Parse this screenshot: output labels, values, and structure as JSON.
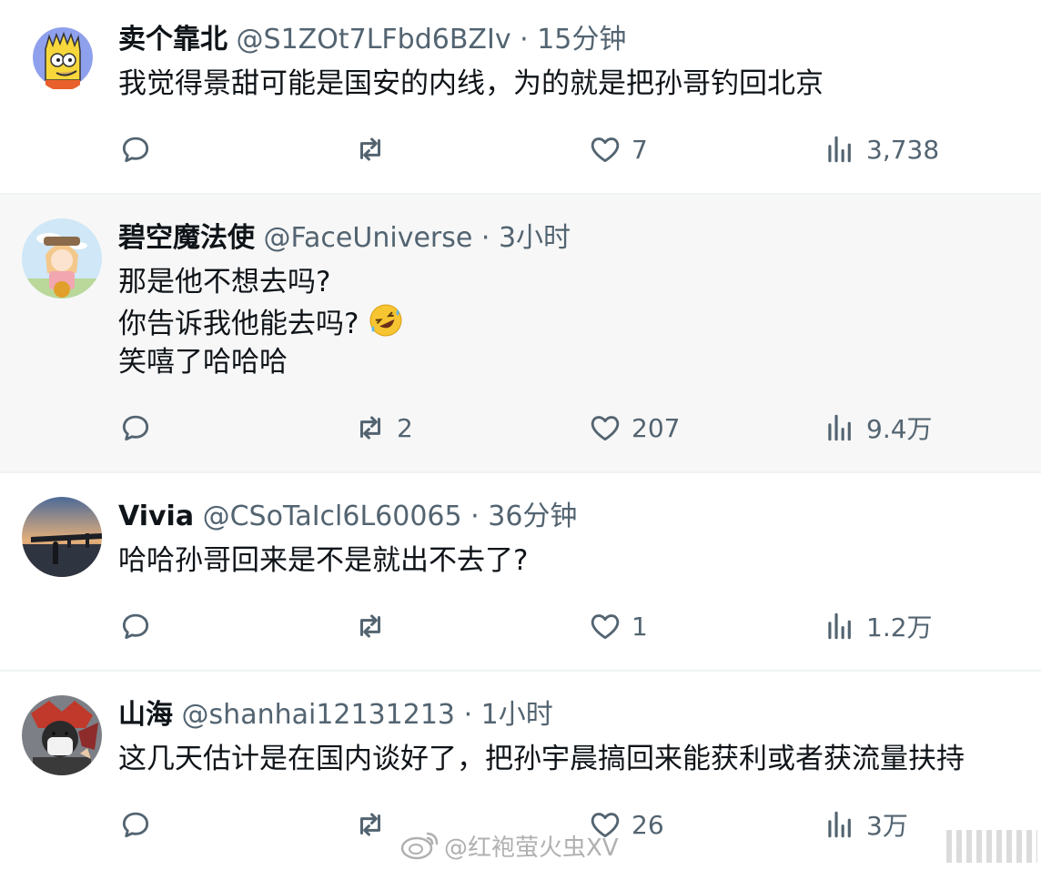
{
  "posts": [
    {
      "name": "卖个靠北",
      "handle": "@S1ZOt7LFbd6BZIv",
      "time": "· 15分钟",
      "lines": [
        "我觉得景甜可能是国安的内线，为的就是把孙哥钓回北京"
      ],
      "replies": "",
      "reposts": "",
      "likes": "7",
      "views": "3,738"
    },
    {
      "name": "碧空魔法使",
      "handle": "@FaceUniverse",
      "time": "· 3小时",
      "lines": [
        "那是他不想去吗?",
        "你告诉我他能去吗?",
        "笑嘻了哈哈哈"
      ],
      "replies": "",
      "reposts": "2",
      "likes": "207",
      "views": "9.4万"
    },
    {
      "name": "Vivia",
      "handle": "@CSoTaIcl6L60065",
      "time": "· 36分钟",
      "lines": [
        "哈哈孙哥回来是不是就出不去了?"
      ],
      "replies": "",
      "reposts": "",
      "likes": "1",
      "views": "1.2万"
    },
    {
      "name": "山海",
      "handle": "@shanhai12131213",
      "time": "· 1小时",
      "lines": [
        "这几天估计是在国内谈好了，把孙宇晨搞回来能获利或者获流量扶持"
      ],
      "replies": "",
      "reposts": "",
      "likes": "26",
      "views": "3万"
    }
  ],
  "icons": {
    "reply": "reply-icon",
    "repost": "repost-icon",
    "like": "heart-icon",
    "views": "views-icon",
    "emoji": "rofl-emoji"
  },
  "watermark": "@红袍萤火虫XV",
  "colors": {
    "text": "#0f1419",
    "meta": "#536471",
    "divider": "#eff3f4",
    "highlight_bg": "#f7f7f7"
  }
}
